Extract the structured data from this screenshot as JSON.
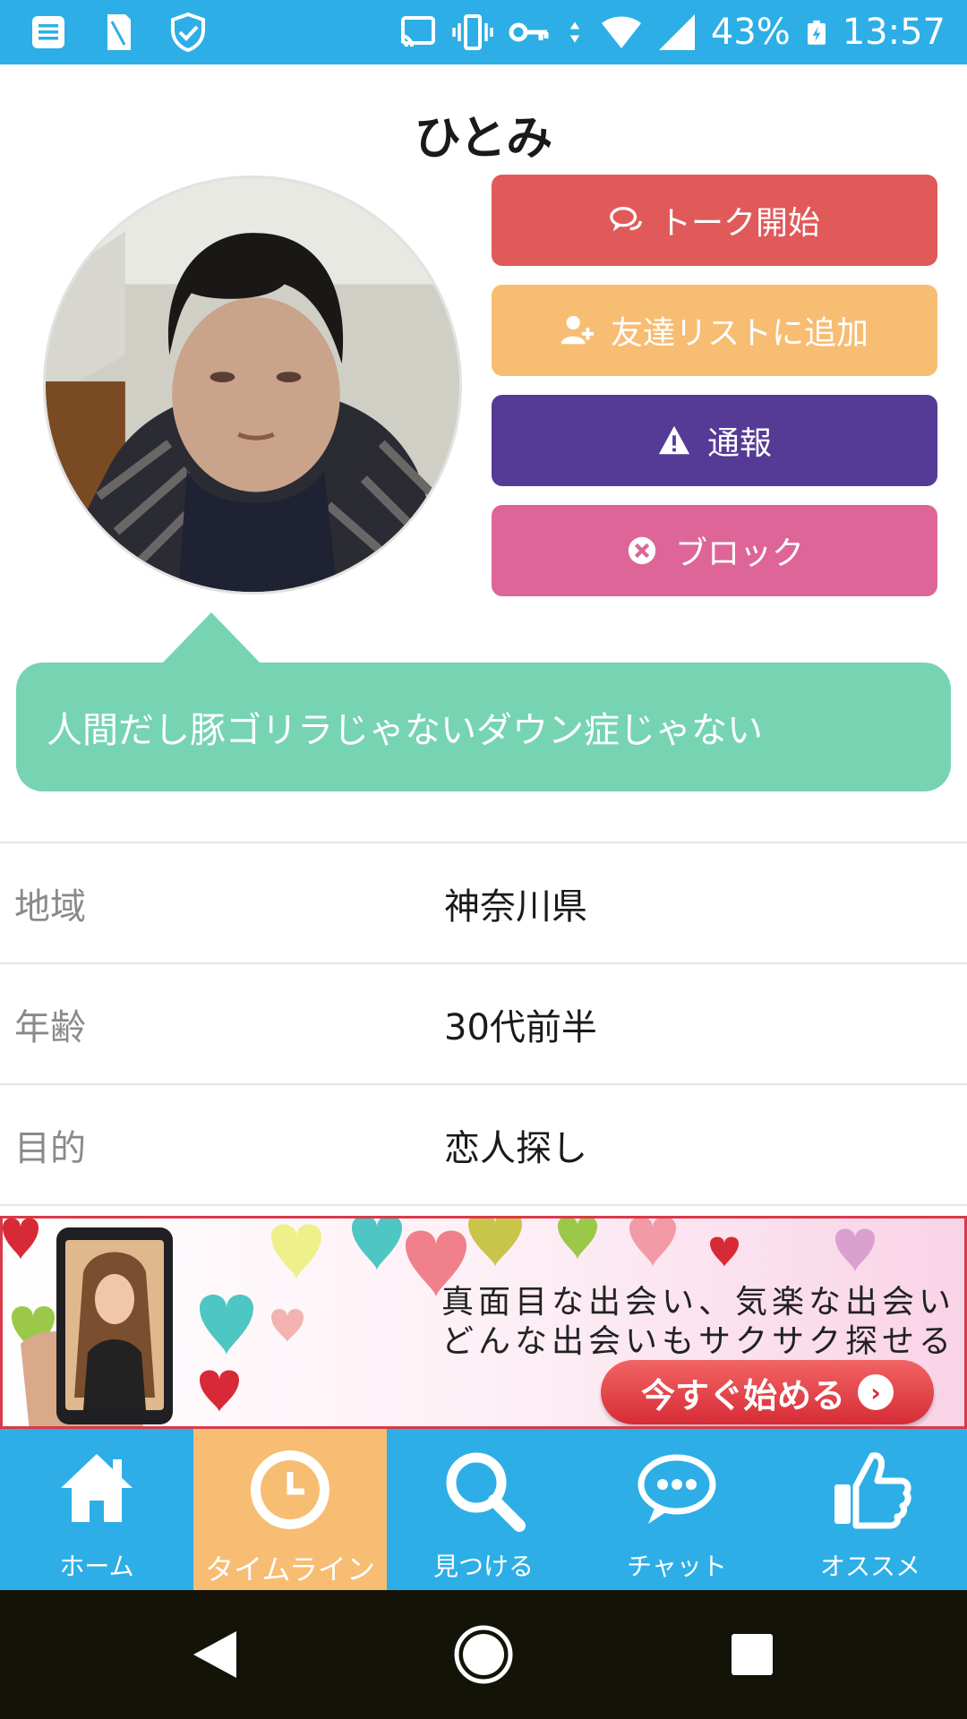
{
  "status_bar": {
    "battery": "43%",
    "time": "13:57",
    "icons_left": [
      "notes-icon",
      "sim-icon",
      "shield-check-icon"
    ],
    "icons_right": [
      "cast-icon",
      "vibrate-icon",
      "vpn-key-icon",
      "data-arrows-icon",
      "wifi-icon",
      "signal-icon",
      "battery-charging-icon"
    ]
  },
  "profile": {
    "name": "ひとみ",
    "bio": "人間だし豚ゴリラじゃないダウン症じゃない"
  },
  "actions": {
    "talk": "トーク開始",
    "add_friend": "友達リストに追加",
    "report": "通報",
    "block": "ブロック"
  },
  "info": [
    {
      "label": "地域",
      "value": "神奈川県"
    },
    {
      "label": "年齢",
      "value": "30代前半"
    },
    {
      "label": "目的",
      "value": "恋人探し"
    }
  ],
  "ad": {
    "line1": "真面目な出会い、気楽な出会い",
    "line2": "どんな出会いもサクサク探せる",
    "cta": "今すぐ始める"
  },
  "tabs": [
    {
      "label": "ホーム",
      "icon": "home-icon"
    },
    {
      "label": "タイムライン",
      "icon": "clock-icon"
    },
    {
      "label": "見つける",
      "icon": "search-icon"
    },
    {
      "label": "チャット",
      "icon": "chat-bubble-icon"
    },
    {
      "label": "オススメ",
      "icon": "thumbs-up-icon"
    }
  ],
  "active_tab": "タイムライン",
  "colors": {
    "status_bar": "#2eaee6",
    "talk_button": "#e05a5a",
    "add_friend_button": "#f7bd73",
    "report_button": "#553b95",
    "block_button": "#de6597",
    "bubble": "#76d4b3",
    "tab_bar": "#2eaee6",
    "active_tab": "#f7bd73"
  }
}
